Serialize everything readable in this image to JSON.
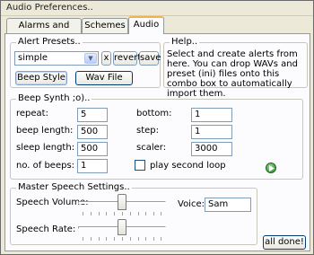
{
  "window": {
    "title": "Audio Preferences.."
  },
  "tabs": [
    {
      "label": "Alarms and Chimes"
    },
    {
      "label": "Schemes"
    },
    {
      "label": "Audio",
      "active": true
    }
  ],
  "alert_presets": {
    "label": "Alert Presets..",
    "selected": "simple",
    "clear_label": "x",
    "revert_label": "revert",
    "save_label": "save",
    "beep_style_label": "Beep Style",
    "wav_file_label": "Wav File"
  },
  "help": {
    "label": "Help..",
    "text": "Select and create alerts from here. You can drop WAVs and preset (ini) files onto this combo box to automatically import them."
  },
  "beep_synth": {
    "label": "Beep Synth ;o)..",
    "repeat_label": "repeat:",
    "repeat_value": "5",
    "beep_length_label": "beep length:",
    "beep_length_value": "500",
    "sleep_length_label": "sleep length:",
    "sleep_length_value": "500",
    "beeps_label": "no. of beeps:",
    "beeps_value": "1",
    "bottom_label": "bottom:",
    "bottom_value": "1",
    "step_label": "step:",
    "step_value": "1",
    "scaler_label": "scaler:",
    "scaler_value": "3000",
    "second_loop_label": "play second loop",
    "second_loop_checked": false
  },
  "speech": {
    "label": "Master Speech Settings..",
    "volume_label": "Speech Volume:",
    "volume_level": 0.5,
    "rate_label": "Speech Rate:",
    "rate_level": 0.5,
    "voice_label": "Voice:",
    "voice_value": "Sam"
  },
  "footer": {
    "done_label": "all done!"
  },
  "icons": {
    "play": "play-icon",
    "dropdown": "chevron-down-icon"
  },
  "colors": {
    "accent": "#f6b24a",
    "play_green": "#2c8a2c"
  }
}
